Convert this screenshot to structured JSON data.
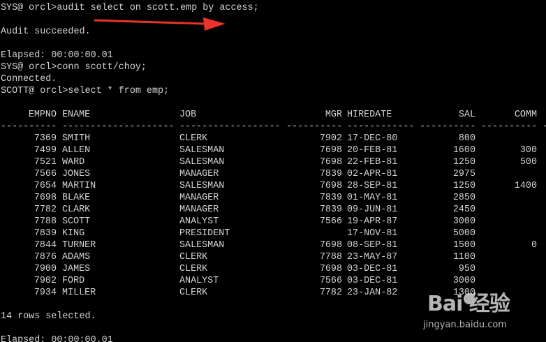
{
  "terminal": {
    "lines": {
      "cmd_audit": "SYS@ orcl>audit select on scott.emp by access;",
      "audit_result": "Audit succeeded.",
      "elapsed_1": "Elapsed: 00:00:00.01",
      "cmd_conn": "SYS@ orcl>conn scott/choy;",
      "connected": "Connected.",
      "cmd_select": "SCOTT@ orcl>select * from emp;",
      "rows_selected": "14 rows selected.",
      "elapsed_2": "Elapsed: 00:00:00.01"
    },
    "table": {
      "headers": [
        "EMPNO",
        "ENAME",
        "JOB",
        "MGR",
        "HIREDATE",
        "SAL",
        "COMM"
      ],
      "separator": {
        "empno": "----------",
        "ename": "--------------------",
        "job": "------------------",
        "mgr": "----------",
        "hiredate": "------------",
        "sal": "----------",
        "comm": "----------",
        "tail": "-"
      },
      "rows": [
        [
          "7369",
          "SMITH",
          "CLERK",
          "7902",
          "17-DEC-80",
          "800",
          ""
        ],
        [
          "7499",
          "ALLEN",
          "SALESMAN",
          "7698",
          "20-FEB-81",
          "1600",
          "300"
        ],
        [
          "7521",
          "WARD",
          "SALESMAN",
          "7698",
          "22-FEB-81",
          "1250",
          "500"
        ],
        [
          "7566",
          "JONES",
          "MANAGER",
          "7839",
          "02-APR-81",
          "2975",
          ""
        ],
        [
          "7654",
          "MARTIN",
          "SALESMAN",
          "7698",
          "28-SEP-81",
          "1250",
          "1400"
        ],
        [
          "7698",
          "BLAKE",
          "MANAGER",
          "7839",
          "01-MAY-81",
          "2850",
          ""
        ],
        [
          "7782",
          "CLARK",
          "MANAGER",
          "7839",
          "09-JUN-81",
          "2450",
          ""
        ],
        [
          "7788",
          "SCOTT",
          "ANALYST",
          "7566",
          "19-APR-87",
          "3000",
          ""
        ],
        [
          "7839",
          "KING",
          "PRESIDENT",
          "",
          "17-NOV-81",
          "5000",
          ""
        ],
        [
          "7844",
          "TURNER",
          "SALESMAN",
          "7698",
          "08-SEP-81",
          "1500",
          "0"
        ],
        [
          "7876",
          "ADAMS",
          "CLERK",
          "7788",
          "23-MAY-87",
          "1100",
          ""
        ],
        [
          "7900",
          "JAMES",
          "CLERK",
          "7698",
          "03-DEC-81",
          "950",
          ""
        ],
        [
          "7902",
          "FORD",
          "ANALYST",
          "7566",
          "03-DEC-81",
          "3000",
          ""
        ],
        [
          "7934",
          "MILLER",
          "CLERK",
          "7782",
          "23-JAN-82",
          "1300",
          ""
        ]
      ]
    }
  },
  "watermark": {
    "logo_text": "Bai 经验",
    "url": "jingyan.baidu.com"
  },
  "colors": {
    "background": "#000000",
    "text": "#d4d4d4",
    "arrow": "#e8342a"
  },
  "icons": {
    "annotation": "red-arrow-icon",
    "watermark": "baidu-paw-icon"
  }
}
